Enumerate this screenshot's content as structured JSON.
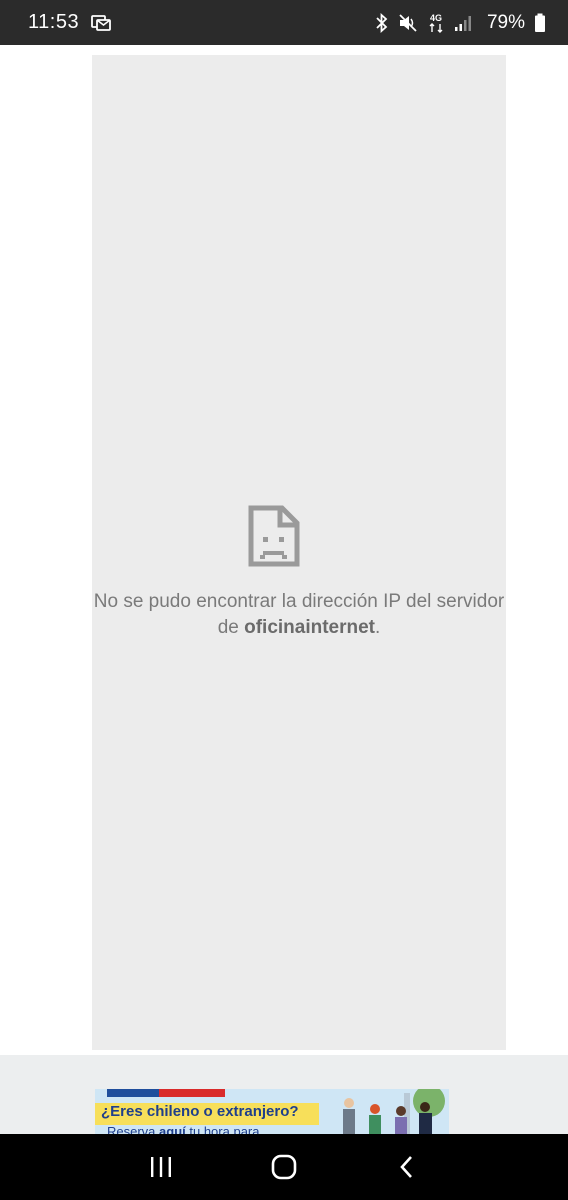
{
  "status_bar": {
    "time": "11:53",
    "battery_percent": "79%",
    "network": "4G",
    "icons": [
      "message-icon",
      "bluetooth-icon",
      "mute-icon",
      "4g-data-icon",
      "signal-icon",
      "battery-icon"
    ]
  },
  "error": {
    "icon": "broken-page-icon",
    "message_prefix": "No se pudo encontrar la dirección IP del servidor de ",
    "host": "oficinainternet",
    "message_suffix": "."
  },
  "banner": {
    "title": "¿Eres chileno o extranjero?",
    "subtitle_prefix": "Reserva ",
    "subtitle_bold": "aquí",
    "subtitle_suffix": " tu hora para",
    "colors": {
      "blue": "#1f4e9c",
      "red": "#d92b2b",
      "highlight": "#f7df5a"
    }
  },
  "nav_bar": {
    "buttons": [
      "recent-apps-icon",
      "home-icon",
      "back-icon"
    ]
  }
}
